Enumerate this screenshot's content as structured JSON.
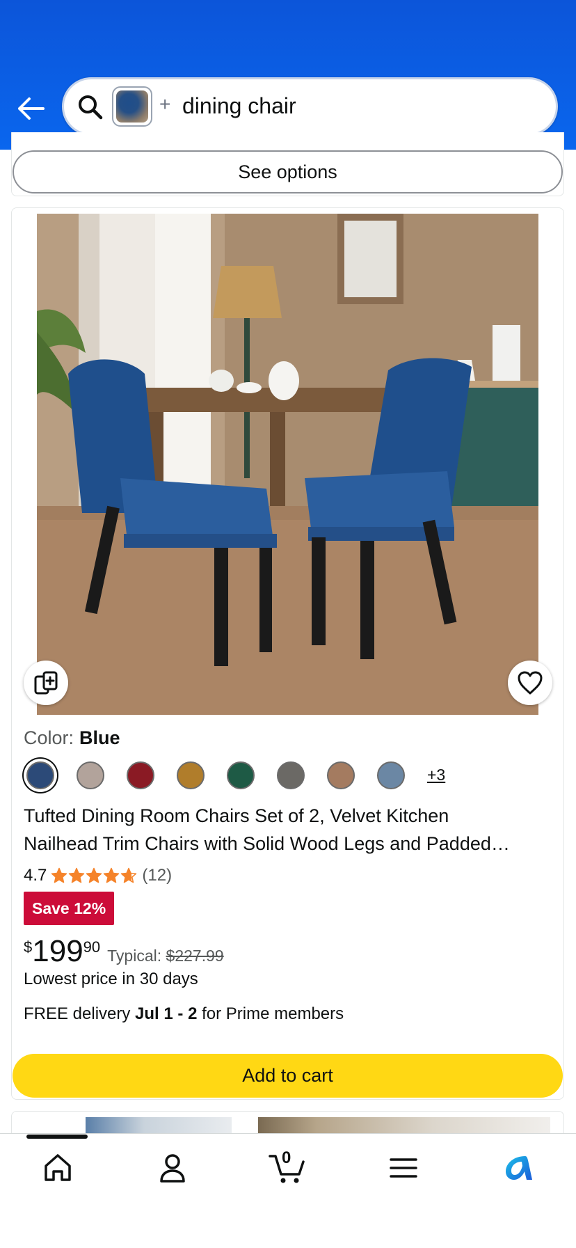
{
  "search": {
    "query": "dining chair",
    "plus": "+"
  },
  "previous_card": {
    "see_options_label": "See options"
  },
  "product": {
    "color_label": "Color:",
    "color_value": "Blue",
    "swatches": [
      "#2c4a78",
      "#b2a39b",
      "#8a1a24",
      "#b07d2b",
      "#1e5a45",
      "#6b6965",
      "#a47b60",
      "#6b87a4"
    ],
    "more_swatches": "+3",
    "title_line1": "Tufted Dining Room Chairs Set of 2, Velvet Kitchen",
    "title_line2": "Nailhead Trim Chairs with Solid Wood Legs and Padded…",
    "rating": "4.7",
    "rating_value": 4.7,
    "review_count": "(12)",
    "save_badge": "Save 12%",
    "price_symbol": "$",
    "price_whole": "199",
    "price_fraction": "90",
    "typical_label": "Typical:",
    "typical_price": "$227.99",
    "lowest_price_note": "Lowest price in 30 days",
    "delivery_prefix": "FREE delivery",
    "delivery_dates": "Jul 1 - 2",
    "delivery_suffix": "for Prime members",
    "add_to_cart_label": "Add to cart"
  },
  "nav": {
    "cart_count": "0",
    "items": [
      "home-icon",
      "account-icon",
      "cart-icon",
      "menu-icon",
      "rufus-icon"
    ]
  },
  "colors": {
    "header_blue": "#0a66ee",
    "add_to_cart_yellow": "#ffd814",
    "save_badge_red": "#cc0c39",
    "star_orange": "#f5832a"
  }
}
